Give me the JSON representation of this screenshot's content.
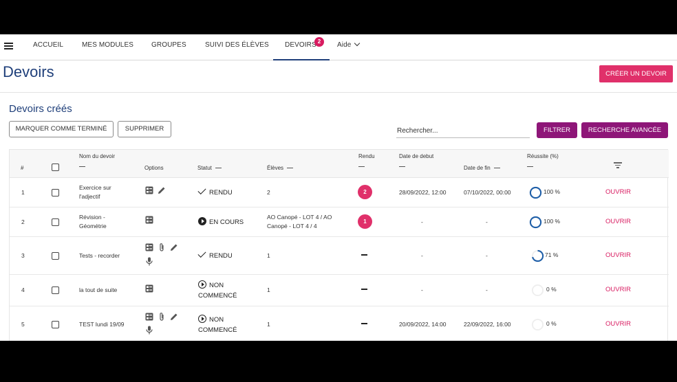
{
  "nav": {
    "items": [
      "ACCUEIL",
      "MES MODULES",
      "GROUPES",
      "SUIVI DES ÉLÈVES",
      "DEVOIRS",
      "Aide"
    ],
    "badge_count": "2"
  },
  "page": {
    "title": "Devoirs",
    "create_button": "CRÉER UN DEVOIR"
  },
  "section": {
    "title": "Devoirs créés",
    "mark_done": "MARQUER COMME TERMINÉ",
    "delete": "SUPPRIMER",
    "search_placeholder": "Rechercher...",
    "filter": "FILTRER",
    "advanced_search": "RECHERCHE AVANCÉE"
  },
  "table": {
    "headers": {
      "num": "#",
      "name": "Nom du devoir",
      "options": "Options",
      "status": "Statut",
      "students": "Élèves",
      "returned": "Rendu",
      "start": "Date de debut",
      "end": "Date de fin",
      "success": "Réussite (%)"
    },
    "open_label": "OUVRIR",
    "rows": [
      {
        "num": "1",
        "name": "Exercice sur l'adjectif",
        "status": "RENDU",
        "status_icon": "check-icon",
        "students": "2",
        "returned": "2",
        "start": "28/09/2022, 12:00",
        "end": "07/10/2022, 00:00",
        "success": "100 %",
        "success_value": 100
      },
      {
        "num": "2",
        "name": "Révision - Géométrie",
        "status": "EN COURS",
        "status_icon": "play-filled-icon",
        "students": "AO Canopé - LOT 4 / AO Canopé - LOT 4 / 4",
        "returned": "1",
        "start": "-",
        "end": "-",
        "success": "100 %",
        "success_value": 100
      },
      {
        "num": "3",
        "name": "Tests - recorder",
        "status": "RENDU",
        "status_icon": "check-icon",
        "students": "1",
        "returned": "",
        "start": "-",
        "end": "-",
        "success": "71 %",
        "success_value": 71
      },
      {
        "num": "4",
        "name": "la tout de suite",
        "status": "NON COMMENCÉ",
        "status_icon": "play-outline-icon",
        "students": "1",
        "returned": "",
        "start": "-",
        "end": "-",
        "success": "0 %",
        "success_value": 0
      },
      {
        "num": "5",
        "name": "TEST lundi 19/09",
        "status": "NON COMMENCÉ",
        "status_icon": "play-outline-icon",
        "students": "1",
        "returned": "",
        "start": "20/09/2022, 14:00",
        "end": "22/09/2022, 16:00",
        "success": "0 %",
        "success_value": 0
      }
    ]
  },
  "colors": {
    "primary": "#1f3f7a",
    "accent_pink": "#e0306a",
    "purple": "#8e1678"
  }
}
